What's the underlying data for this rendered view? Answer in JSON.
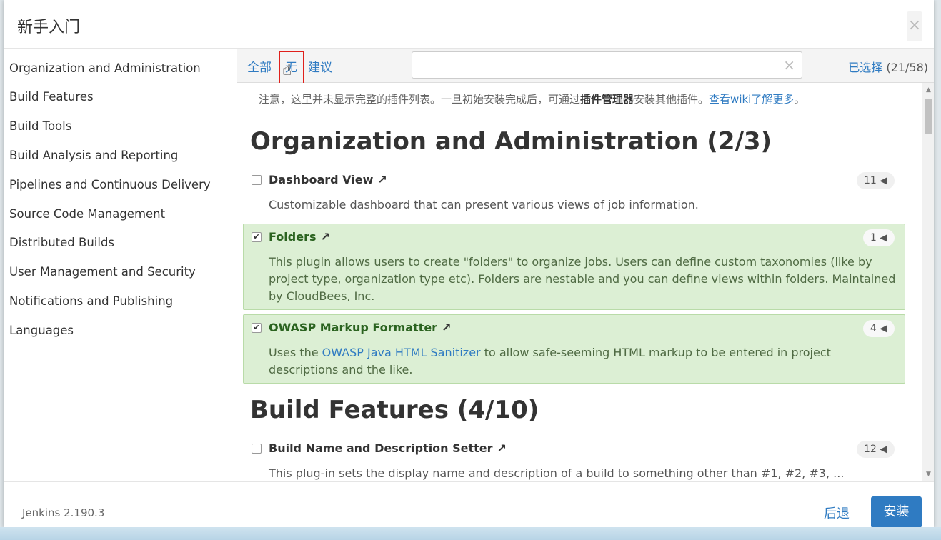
{
  "dialog": {
    "title": "新手入门",
    "close_icon": "×"
  },
  "sidebar": {
    "items": [
      {
        "label": "Organization and Administration"
      },
      {
        "label": "Build Features"
      },
      {
        "label": "Build Tools"
      },
      {
        "label": "Build Analysis and Reporting"
      },
      {
        "label": "Pipelines and Continuous Delivery"
      },
      {
        "label": "Source Code Management"
      },
      {
        "label": "Distributed Builds"
      },
      {
        "label": "User Management and Security"
      },
      {
        "label": "Notifications and Publishing"
      },
      {
        "label": "Languages"
      }
    ]
  },
  "toolbar": {
    "all": "全部",
    "none": "无",
    "suggested": "建议",
    "search_value": "",
    "clear_icon": "×",
    "selected_label": "已选择",
    "selected_count": "(21/58)"
  },
  "notice": {
    "text1": "注意，这里并未显示完整的插件列表。一旦初始安装完成后，可通过",
    "bold": "插件管理器",
    "text2": "安装其他插件。",
    "link": "查看wiki了解更多",
    "end": "。"
  },
  "categories": [
    {
      "title": "Organization and Administration (2/3)",
      "plugins": [
        {
          "name": "Dashboard View",
          "checked": false,
          "deps": "11",
          "desc": "Customizable dashboard that can present various views of job information."
        },
        {
          "name": "Folders",
          "checked": true,
          "deps": "1",
          "desc": "This plugin allows users to create \"folders\" to organize jobs. Users can define custom taxonomies (like by project type, organization type etc). Folders are nestable and you can define views within folders. Maintained by CloudBees, Inc."
        },
        {
          "name": "OWASP Markup Formatter",
          "checked": true,
          "deps": "4",
          "desc_pre": "Uses the ",
          "desc_link": "OWASP Java HTML Sanitizer",
          "desc_post": " to allow safe-seeming HTML markup to be entered in project descriptions and the like."
        }
      ]
    },
    {
      "title": "Build Features (4/10)",
      "plugins": [
        {
          "name": "Build Name and Description Setter",
          "checked": false,
          "deps": "12",
          "desc": "This plug-in sets the display name and description of a build to something other than #1, #2, #3, ..."
        }
      ]
    }
  ],
  "glyphs": {
    "external_arrow": "↗",
    "deps_caret": "◀",
    "check": "✔",
    "cursor": "☝",
    "scroll_up": "▲",
    "scroll_down": "▼"
  },
  "footer": {
    "version": "Jenkins 2.190.3",
    "back": "后退",
    "install": "安装"
  },
  "colors": {
    "accent": "#2f7bc2",
    "selected_bg": "#dcefd4",
    "highlight_box": "#e0201b"
  }
}
